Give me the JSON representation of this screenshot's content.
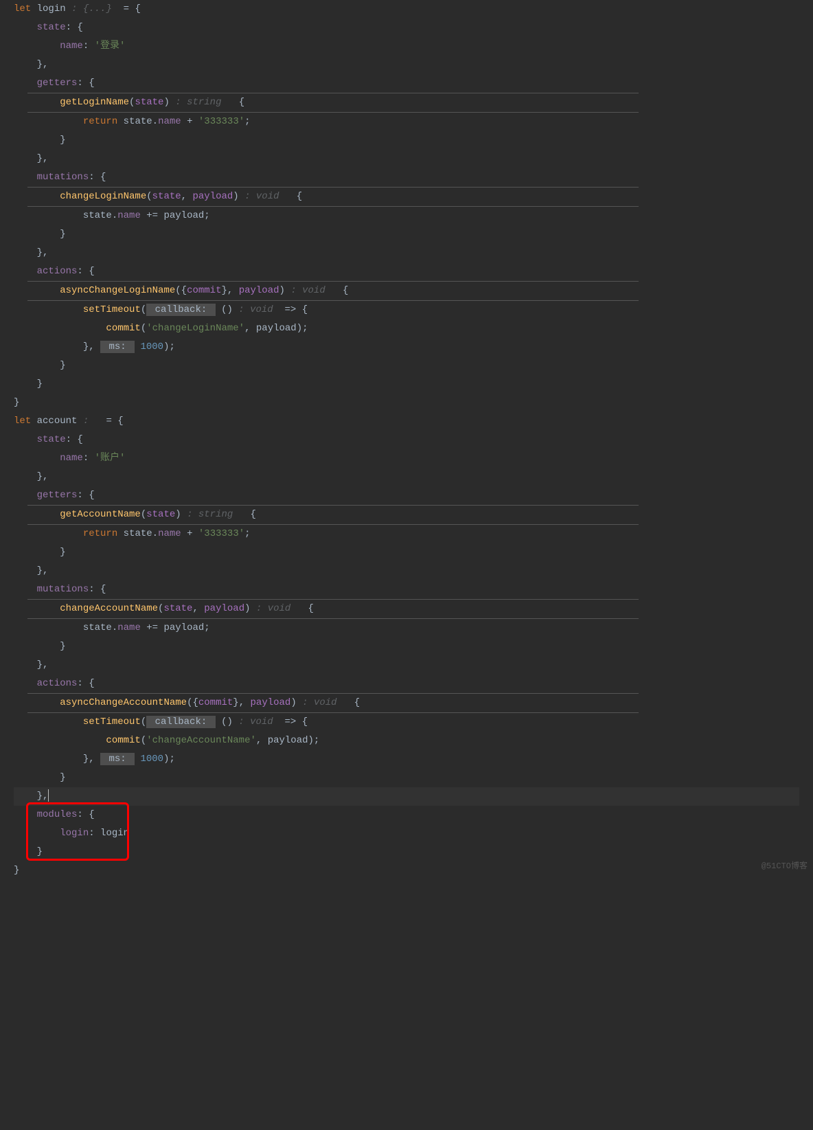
{
  "watermark": "@51CTO博客",
  "code": {
    "l1": {
      "let": "let",
      "login": "login",
      "hint": " : {...} ",
      "eq": " = {"
    },
    "l2": {
      "state": "state",
      "col": ": {"
    },
    "l3": {
      "name": "name",
      "col": ": ",
      "val": "'登录'"
    },
    "l4": "},",
    "l5": {
      "getters": "getters",
      "col": ": {"
    },
    "l6": {
      "fn": "getLoginName",
      "p": "state",
      "hint": " : string ",
      "brace": "  {"
    },
    "l7": {
      "ret": "return",
      "state": "state",
      "dot": ".",
      "name": "name",
      "plus": " + ",
      "val": "'333333'",
      "semi": ";"
    },
    "l8": "}",
    "l9": "},",
    "l10": {
      "mutations": "mutations",
      "col": ": {"
    },
    "l11": {
      "fn": "changeLoginName",
      "p1": "state",
      "c": ", ",
      "p2": "payload",
      "hint": " : void ",
      "brace": "  {"
    },
    "l12": {
      "state": "state",
      "dot": ".",
      "name": "name",
      "plus": " += ",
      "payload": "payload",
      "semi": ";"
    },
    "l13": "}",
    "l14": "},",
    "l15": {
      "actions": "actions",
      "col": ": {"
    },
    "l16": {
      "fn": "asyncChangeLoginName",
      "b": "({",
      "commit": "commit",
      "e": "}, ",
      "payload": "payload",
      "pe": ")",
      "hint": " : void ",
      "brace": "  {"
    },
    "l17": {
      "fn": "setTimeout",
      "op": "(",
      "badge": " callback: ",
      "ar": " ()",
      "hint": " : void ",
      "arrow": " => {"
    },
    "l18": {
      "commit": "commit",
      "op": "(",
      "str": "'changeLoginName'",
      "c": ", ",
      "payload": "payload",
      "cl": ");"
    },
    "l19": {
      "close": "}, ",
      "badge": " ms: ",
      "num": "1000",
      "end": ");"
    },
    "l20": "}",
    "l21": "}",
    "l22": "}",
    "l23": {
      "let": "let",
      "acc": "account",
      "hint": " :  ",
      "eq": " = {"
    },
    "l24": {
      "state": "state",
      "col": ": {"
    },
    "l25": {
      "name": "name",
      "col": ": ",
      "val": "'账户'"
    },
    "l26": "},",
    "l27": {
      "getters": "getters",
      "col": ": {"
    },
    "l28": {
      "fn": "getAccountName",
      "p": "state",
      "hint": " : string ",
      "brace": "  {"
    },
    "l29": {
      "ret": "return",
      "state": "state",
      "dot": ".",
      "name": "name",
      "plus": " + ",
      "val": "'333333'",
      "semi": ";"
    },
    "l30": "}",
    "l31": "},",
    "l32": {
      "mutations": "mutations",
      "col": ": {"
    },
    "l33": {
      "fn": "changeAccountName",
      "p1": "state",
      "c": ", ",
      "p2": "payload",
      "hint": " : void ",
      "brace": "  {"
    },
    "l34": {
      "state": "state",
      "dot": ".",
      "name": "name",
      "plus": " += ",
      "payload": "payload",
      "semi": ";"
    },
    "l35": "}",
    "l36": "},",
    "l37": {
      "actions": "actions",
      "col": ": {"
    },
    "l38": {
      "fn": "asyncChangeAccountName",
      "b": "({",
      "commit": "commit",
      "e": "}, ",
      "payload": "payload",
      "pe": ")",
      "hint": " : void ",
      "brace": "  {"
    },
    "l39": {
      "fn": "setTimeout",
      "op": "(",
      "badge": " callback: ",
      "ar": " ()",
      "hint": " : void ",
      "arrow": " => {"
    },
    "l40": {
      "commit": "commit",
      "op": "(",
      "str": "'changeAccountName'",
      "c": ", ",
      "payload": "payload",
      "cl": ");"
    },
    "l41": {
      "close": "}, ",
      "badge": " ms: ",
      "num": "1000",
      "end": ");"
    },
    "l42": "}",
    "l43": "},",
    "l44": {
      "modules": "modules",
      "col": ": {"
    },
    "l45": {
      "login": "login",
      "col": ": ",
      "val": "login"
    },
    "l46": "}",
    "l47": "}"
  }
}
